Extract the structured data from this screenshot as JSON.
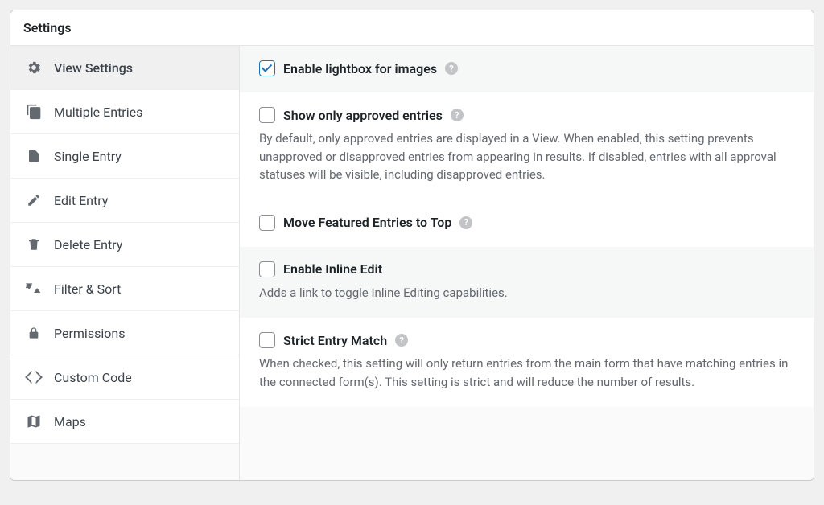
{
  "panel": {
    "title": "Settings"
  },
  "sidebar": {
    "items": [
      {
        "label": "View Settings",
        "icon": "gear-icon",
        "active": true
      },
      {
        "label": "Multiple Entries",
        "icon": "copies-icon",
        "active": false
      },
      {
        "label": "Single Entry",
        "icon": "document-icon",
        "active": false
      },
      {
        "label": "Edit Entry",
        "icon": "pencil-icon",
        "active": false
      },
      {
        "label": "Delete Entry",
        "icon": "trash-icon",
        "active": false
      },
      {
        "label": "Filter & Sort",
        "icon": "sort-icon",
        "active": false
      },
      {
        "label": "Permissions",
        "icon": "lock-icon",
        "active": false
      },
      {
        "label": "Custom Code",
        "icon": "code-icon",
        "active": false
      },
      {
        "label": "Maps",
        "icon": "map-icon",
        "active": false
      }
    ]
  },
  "settings": [
    {
      "key": "enable_lightbox",
      "label": "Enable lightbox for images",
      "checked": true,
      "help": true,
      "description": "",
      "alt_bg": true
    },
    {
      "key": "only_approved",
      "label": "Show only approved entries",
      "checked": false,
      "help": true,
      "description": "By default, only approved entries are displayed in a View. When enabled, this setting prevents unapproved or disapproved entries from appearing in results. If disabled, entries with all approval statuses will be visible, including disapproved entries.",
      "alt_bg": false
    },
    {
      "key": "featured_top",
      "label": "Move Featured Entries to Top",
      "checked": false,
      "help": true,
      "description": "",
      "alt_bg": false
    },
    {
      "key": "inline_edit",
      "label": "Enable Inline Edit",
      "checked": false,
      "help": false,
      "description": "Adds a link to toggle Inline Editing capabilities.",
      "alt_bg": true
    },
    {
      "key": "strict_match",
      "label": "Strict Entry Match",
      "checked": false,
      "help": true,
      "description": "When checked, this setting will only return entries from the main form that have matching entries in the connected form(s). This setting is strict and will reduce the number of results.",
      "alt_bg": false
    }
  ],
  "glyphs": {
    "help": "?"
  }
}
